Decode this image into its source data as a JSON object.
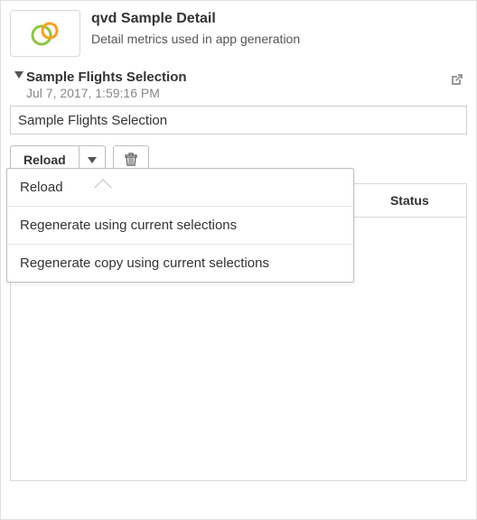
{
  "app": {
    "title": "qvd Sample Detail",
    "subtitle": "Detail metrics used in app generation"
  },
  "selection": {
    "title": "Sample Flights Selection",
    "timestamp": "Jul 7, 2017, 1:59:16 PM"
  },
  "nameInput": {
    "value": "Sample Flights Selection"
  },
  "buttons": {
    "reload": "Reload"
  },
  "dropdown": {
    "items": [
      {
        "label": "Reload"
      },
      {
        "label": "Regenerate using current selections"
      },
      {
        "label": "Regenerate copy using current selections"
      }
    ]
  },
  "table": {
    "columns": [
      {
        "label": ""
      },
      {
        "label": ""
      },
      {
        "label": ""
      },
      {
        "label": "Status"
      }
    ]
  }
}
